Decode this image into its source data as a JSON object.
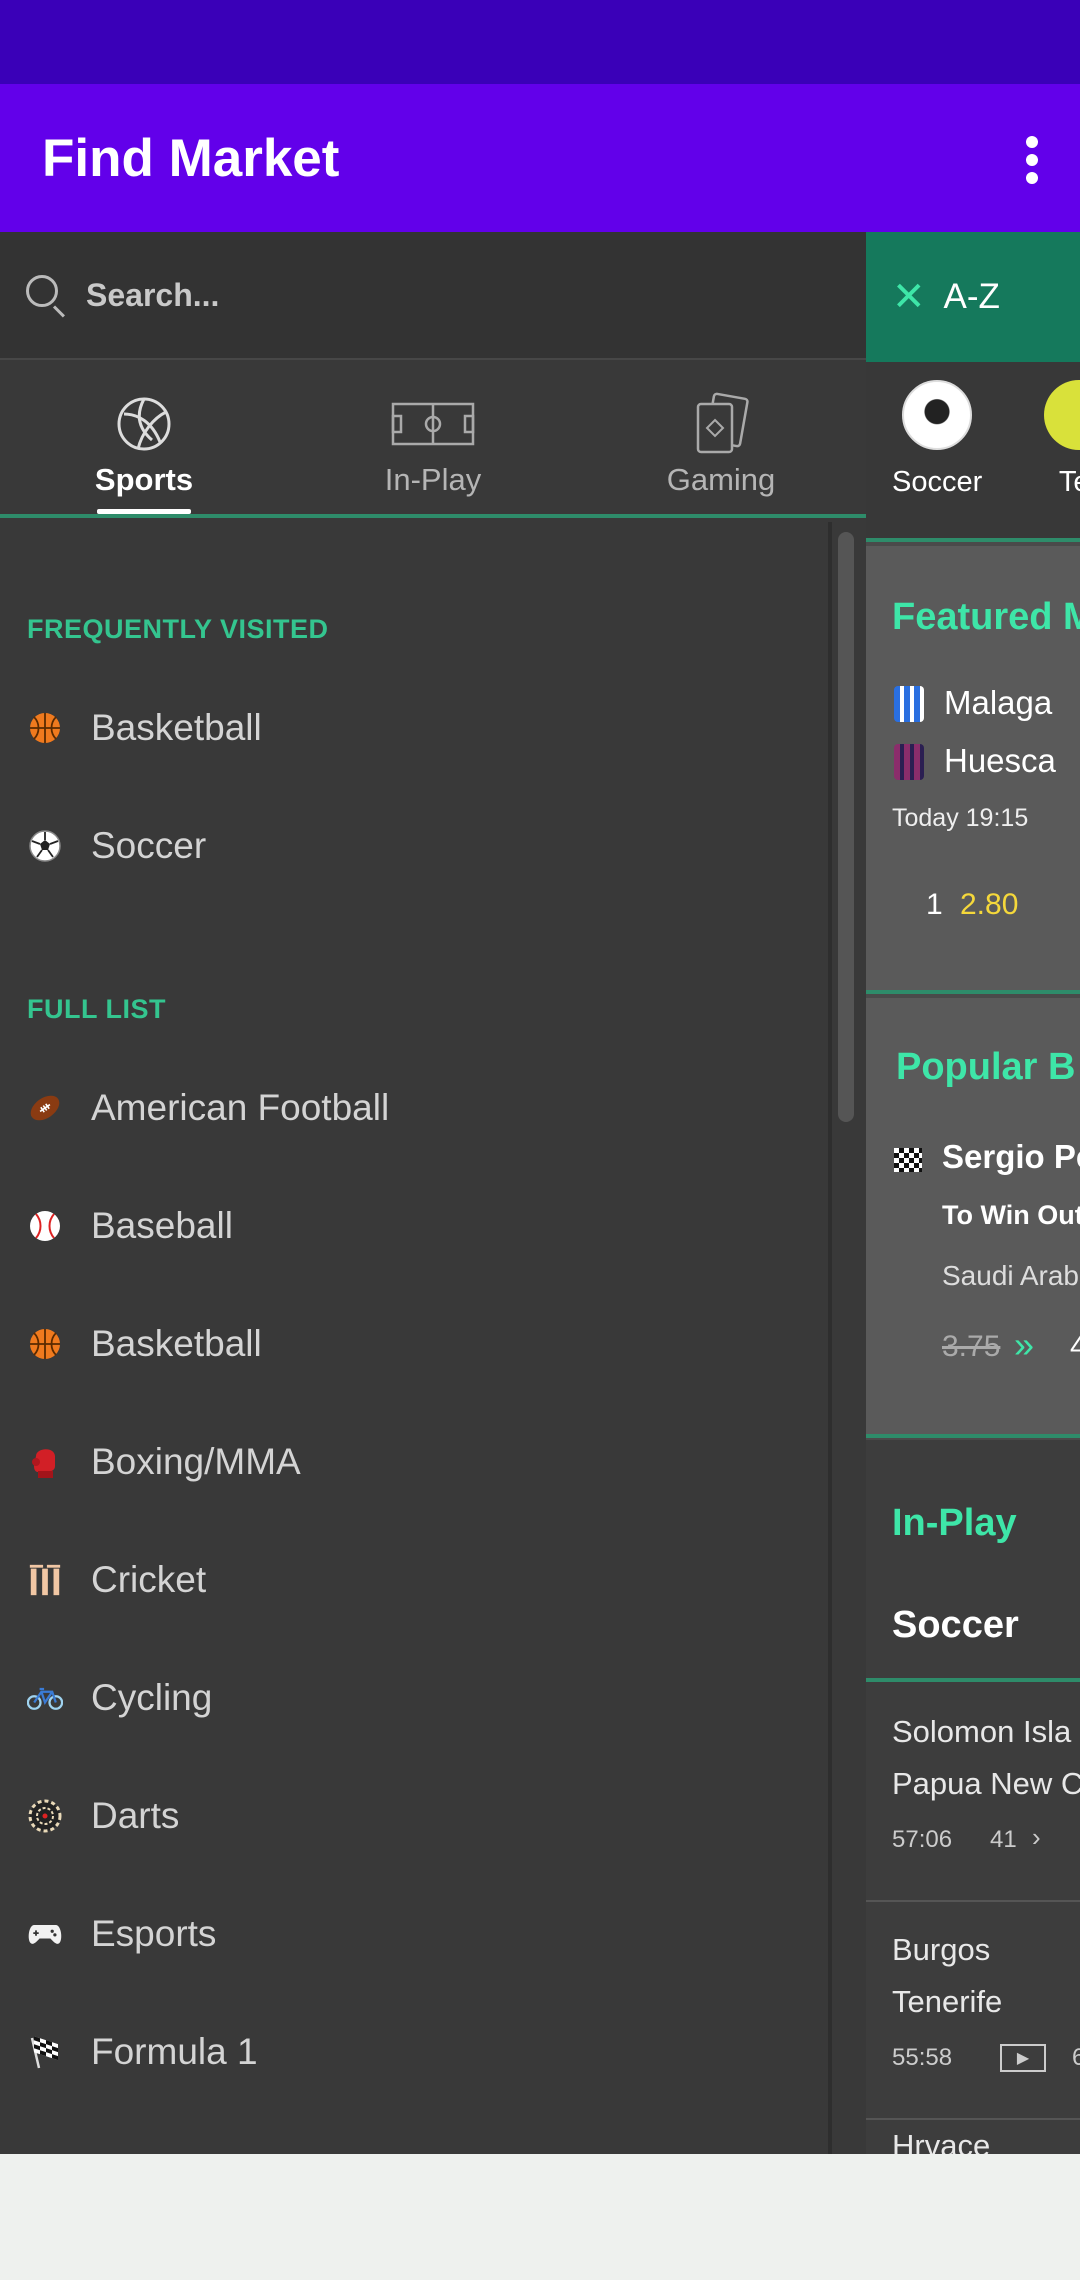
{
  "app": {
    "title": "Find Market"
  },
  "search": {
    "placeholder": "Search..."
  },
  "tabs": [
    {
      "label": "Sports",
      "active": true,
      "icon": "volleyball-icon"
    },
    {
      "label": "In-Play",
      "active": false,
      "icon": "pitch-icon"
    },
    {
      "label": "Gaming",
      "active": false,
      "icon": "cards-icon"
    }
  ],
  "sections": {
    "frequent": {
      "heading": "FREQUENTLY VISITED",
      "items": [
        {
          "label": "Basketball",
          "icon": "basketball-icon"
        },
        {
          "label": "Soccer",
          "icon": "soccer-ball-icon"
        }
      ]
    },
    "full": {
      "heading": "FULL LIST",
      "items": [
        {
          "label": "American Football",
          "icon": "american-football-icon"
        },
        {
          "label": "Baseball",
          "icon": "baseball-icon"
        },
        {
          "label": "Basketball",
          "icon": "basketball-icon"
        },
        {
          "label": "Boxing/MMA",
          "icon": "boxing-glove-icon"
        },
        {
          "label": "Cricket",
          "icon": "cricket-stumps-icon"
        },
        {
          "label": "Cycling",
          "icon": "bicycle-icon"
        },
        {
          "label": "Darts",
          "icon": "dartboard-icon"
        },
        {
          "label": "Esports",
          "icon": "gamepad-icon"
        },
        {
          "label": "Formula 1",
          "icon": "checkered-flag-icon"
        }
      ]
    }
  },
  "background": {
    "az_label": "A-Z",
    "strip": [
      {
        "label": "Soccer"
      },
      {
        "label": "Ter"
      }
    ],
    "featured": {
      "title": "Featured M",
      "team1": "Malaga",
      "team2": "Huesca",
      "time": "Today 19:15",
      "odd_label": "1",
      "odd_value": "2.80"
    },
    "popular": {
      "title": "Popular B",
      "name": "Sergio Pe",
      "market": "To Win Out",
      "event": "Saudi Arab",
      "old_odds": "3.75",
      "new_odds": "4"
    },
    "inplay": {
      "title": "In-Play",
      "sport": "Soccer",
      "match1_team1": "Solomon Isla",
      "match1_team2": "Papua New C",
      "match1_time": "57:06",
      "match1_count": "41",
      "match2_team1": "Burgos",
      "match2_team2": "Tenerife",
      "match2_time": "55:58",
      "match2_count": "6",
      "match3_team1": "Hrvace"
    }
  }
}
